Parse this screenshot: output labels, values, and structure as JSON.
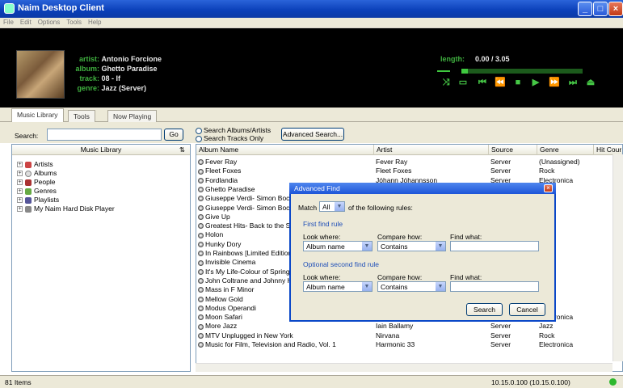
{
  "window": {
    "title": "Naim Desktop Client"
  },
  "menu": [
    "File",
    "Edit",
    "Options",
    "Tools",
    "Help"
  ],
  "now_playing": {
    "labels": {
      "artist": "artist:",
      "album": "album:",
      "track": "track:",
      "genre": "genre:",
      "length": "length:"
    },
    "artist": "Antonio Forcione",
    "album": "Ghetto Paradise",
    "track": "08 - If",
    "genre": "Jazz (Server)",
    "length": "0.00 / 3.05",
    "progress": 0.05
  },
  "tabs": [
    "Music Library",
    "Tools",
    "Now Playing"
  ],
  "search": {
    "label": "Search:",
    "go": "Go",
    "opt_albums": "Search Albums/Artists",
    "opt_tracks": "Search Tracks Only",
    "advanced": "Advanced Search..."
  },
  "library": {
    "header": "Music Library",
    "items": [
      "Artists",
      "Albums",
      "People",
      "Genres",
      "Playlists",
      "My Naim Hard Disk Player"
    ]
  },
  "table": {
    "columns": [
      "Album Name",
      "Artist",
      "Source",
      "Genre",
      "Hit Cour"
    ],
    "rows": [
      {
        "album": "Fever Ray",
        "artist": "Fever Ray",
        "source": "Server",
        "genre": "(Unassigned)",
        "hits": "1"
      },
      {
        "album": "Fleet Foxes",
        "artist": "Fleet Foxes",
        "source": "Server",
        "genre": "Rock",
        "hits": "1"
      },
      {
        "album": "Fordlandia",
        "artist": "Jóhann Jóhannsson",
        "source": "Server",
        "genre": "Electronica",
        "hits": ""
      },
      {
        "album": "Ghetto Paradise",
        "artist": "",
        "source": "",
        "genre": "",
        "hits": "1"
      },
      {
        "album": "Giuseppe Verdi- Simon Boccane",
        "artist": "",
        "source": "",
        "genre": "",
        "hits": "1"
      },
      {
        "album": "Giuseppe Verdi- Simon Boccane",
        "artist": "",
        "source": "",
        "genre": "",
        "hits": ""
      },
      {
        "album": "Give Up",
        "artist": "",
        "source": "",
        "genre": "",
        "hits": ""
      },
      {
        "album": "Greatest Hits- Back to the Star",
        "artist": "",
        "source": "",
        "genre": "",
        "hits": ""
      },
      {
        "album": "Holon",
        "artist": "",
        "source": "",
        "genre": "",
        "hits": "1"
      },
      {
        "album": "Hunky Dory",
        "artist": "",
        "source": "",
        "genre": "",
        "hits": ""
      },
      {
        "album": "In Rainbows [Limited Edition]",
        "artist": "",
        "source": "",
        "genre": "",
        "hits": ""
      },
      {
        "album": "Invisible Cinema",
        "artist": "",
        "source": "",
        "genre": "",
        "hits": ""
      },
      {
        "album": "It's My Life-Colour of Spring-S",
        "artist": "",
        "source": "",
        "genre": "",
        "hits": ""
      },
      {
        "album": "John Coltrane and Johnny Har",
        "artist": "",
        "source": "",
        "genre": "",
        "hits": "1"
      },
      {
        "album": "Mass in F Minor",
        "artist": "",
        "source": "",
        "genre": "",
        "hits": ""
      },
      {
        "album": "Mellow Gold",
        "artist": "",
        "source": "",
        "genre": "",
        "hits": ""
      },
      {
        "album": "Modus Operandi",
        "artist": "",
        "source": "",
        "genre": "nica",
        "hits": ""
      },
      {
        "album": "Moon Safari",
        "artist": "Air",
        "source": "Server",
        "genre": "Electronica",
        "hits": ""
      },
      {
        "album": "More Jazz",
        "artist": "Iain Ballamy",
        "source": "Server",
        "genre": "Jazz",
        "hits": ""
      },
      {
        "album": "MTV Unplugged in New York",
        "artist": "Nirvana",
        "source": "Server",
        "genre": "Rock",
        "hits": ""
      },
      {
        "album": "Music for Film, Television and Radio, Vol. 1",
        "artist": "Harmonic 33",
        "source": "Server",
        "genre": "Electronica",
        "hits": ""
      }
    ]
  },
  "dialog": {
    "title": "Advanced Find",
    "match_label": "Match",
    "match_value": "All",
    "match_suffix": "of the following rules:",
    "first_rule": "First find rule",
    "second_rule": "Optional second find rule",
    "look_where": "Look where:",
    "compare_how": "Compare how:",
    "find_what": "Find what:",
    "look_value": "Album name",
    "compare_value": "Contains",
    "search": "Search",
    "cancel": "Cancel"
  },
  "status": {
    "items": "81 Items",
    "address": "10.15.0.100 (10.15.0.100)"
  },
  "colors": {
    "accent": "#3fb03f",
    "title_blue": "#0a3fb8"
  }
}
